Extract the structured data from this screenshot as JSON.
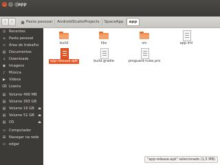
{
  "window": {
    "title": "app",
    "buttons": {
      "close": "×",
      "minimize": "–",
      "maximize": "□"
    }
  },
  "toolbar": {
    "back_icon": "‹",
    "forward_icon": "›",
    "breadcrumbs": [
      "Pasta pessoal",
      "AndroidStudioProjects",
      "SpaceApp",
      "app"
    ]
  },
  "sidebar": {
    "items": [
      {
        "label": "Recentes",
        "icon": "clock-icon",
        "glyph": "◷"
      },
      {
        "label": "Pasta pessoal",
        "icon": "home-icon",
        "glyph": "⌂"
      },
      {
        "label": "Área de trabalho",
        "icon": "desktop-icon",
        "glyph": "▭"
      },
      {
        "label": "Documentos",
        "icon": "documents-icon",
        "glyph": "▤"
      },
      {
        "label": "Downloads",
        "icon": "download-icon",
        "glyph": "↓"
      },
      {
        "label": "Imagens",
        "icon": "camera-icon",
        "glyph": "◉"
      },
      {
        "label": "Música",
        "icon": "music-icon",
        "glyph": "♪"
      },
      {
        "label": "Vídeos",
        "icon": "video-icon",
        "glyph": "▶"
      },
      {
        "label": "Lixeira",
        "icon": "trash-icon",
        "glyph": "⌫"
      },
      {
        "label": "Volume 499 MB",
        "icon": "drive-icon",
        "glyph": "▤"
      },
      {
        "label": "Volume 393 GB",
        "icon": "drive-icon",
        "glyph": "▤"
      },
      {
        "label": "Volume 16 GB",
        "icon": "drive-icon",
        "glyph": "▤",
        "eject": "⏏"
      },
      {
        "label": "Volume 51 GB",
        "icon": "drive-icon",
        "glyph": "▤",
        "eject": "⏏"
      },
      {
        "label": "OS",
        "icon": "drive-icon",
        "glyph": "▤",
        "eject": "⏏"
      },
      {
        "label": "Computador",
        "icon": "computer-icon",
        "glyph": "▭"
      },
      {
        "label": "Navegar na rede",
        "icon": "network-icon",
        "glyph": "⊞"
      },
      {
        "label": "edgar",
        "icon": "folder-icon",
        "glyph": "▭"
      }
    ]
  },
  "files": [
    {
      "name": "build",
      "type": "folder"
    },
    {
      "name": "libs",
      "type": "folder"
    },
    {
      "name": "src",
      "type": "folder"
    },
    {
      "name": "app.iml",
      "type": "document"
    },
    {
      "name": "app-release.apk",
      "type": "apk",
      "selected": true
    },
    {
      "name": "build.gradle",
      "type": "document"
    },
    {
      "name": "proguard-rules.pro",
      "type": "document"
    }
  ],
  "status_text": "\"app-release.apk\" selecionado (1,5 MB)",
  "colors": {
    "accent": "#e95420",
    "sidebar_bg": "#3c3b37",
    "folder": "#f08a4b"
  }
}
